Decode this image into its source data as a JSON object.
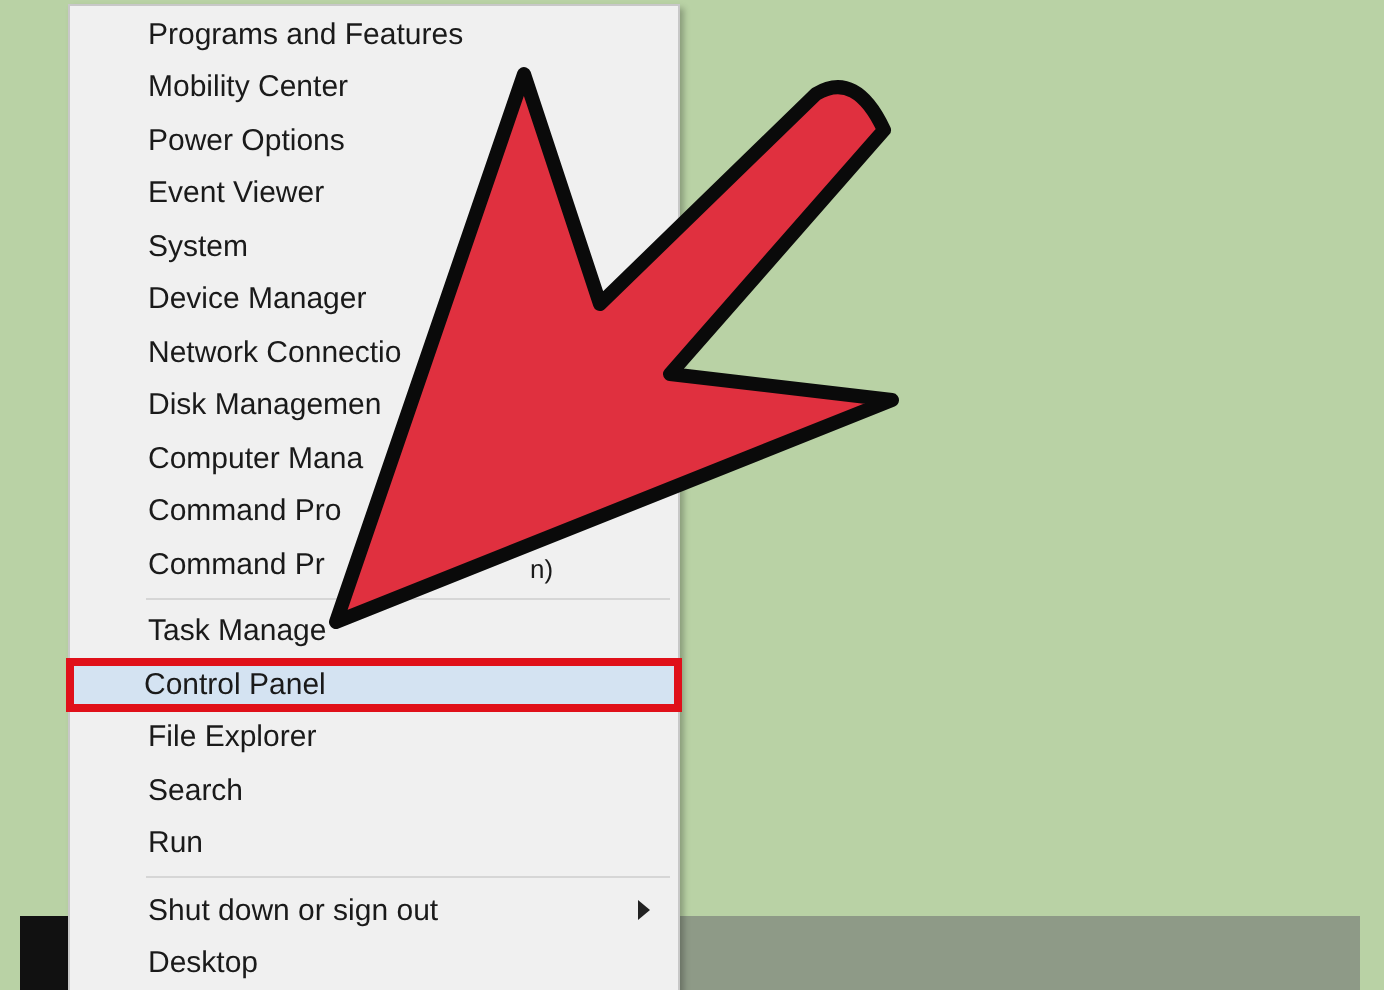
{
  "menu": {
    "groups": [
      {
        "items": [
          {
            "label": "Programs and Features",
            "selected": false
          },
          {
            "label": "Mobility Center",
            "selected": false
          },
          {
            "label": "Power Options",
            "selected": false
          },
          {
            "label": "Event Viewer",
            "selected": false
          },
          {
            "label": "System",
            "selected": false
          },
          {
            "label": "Device Manager",
            "selected": false
          },
          {
            "label": "Network Connectio",
            "selected": false
          },
          {
            "label": "Disk Managemen",
            "selected": false
          },
          {
            "label": "Computer Mana",
            "selected": false
          },
          {
            "label": "Command Pro",
            "selected": false
          },
          {
            "label": "Command Pr",
            "tail": "n)",
            "selected": false
          }
        ]
      },
      {
        "items": [
          {
            "label": "Task Manage",
            "selected": false
          },
          {
            "label": "Control Panel",
            "selected": true
          },
          {
            "label": "File Explorer",
            "selected": false
          },
          {
            "label": "Search",
            "selected": false
          },
          {
            "label": "Run",
            "selected": false
          }
        ]
      },
      {
        "items": [
          {
            "label": "Shut down or sign out",
            "selected": false,
            "submenu": true
          },
          {
            "label": "Desktop",
            "selected": false
          }
        ]
      }
    ]
  }
}
